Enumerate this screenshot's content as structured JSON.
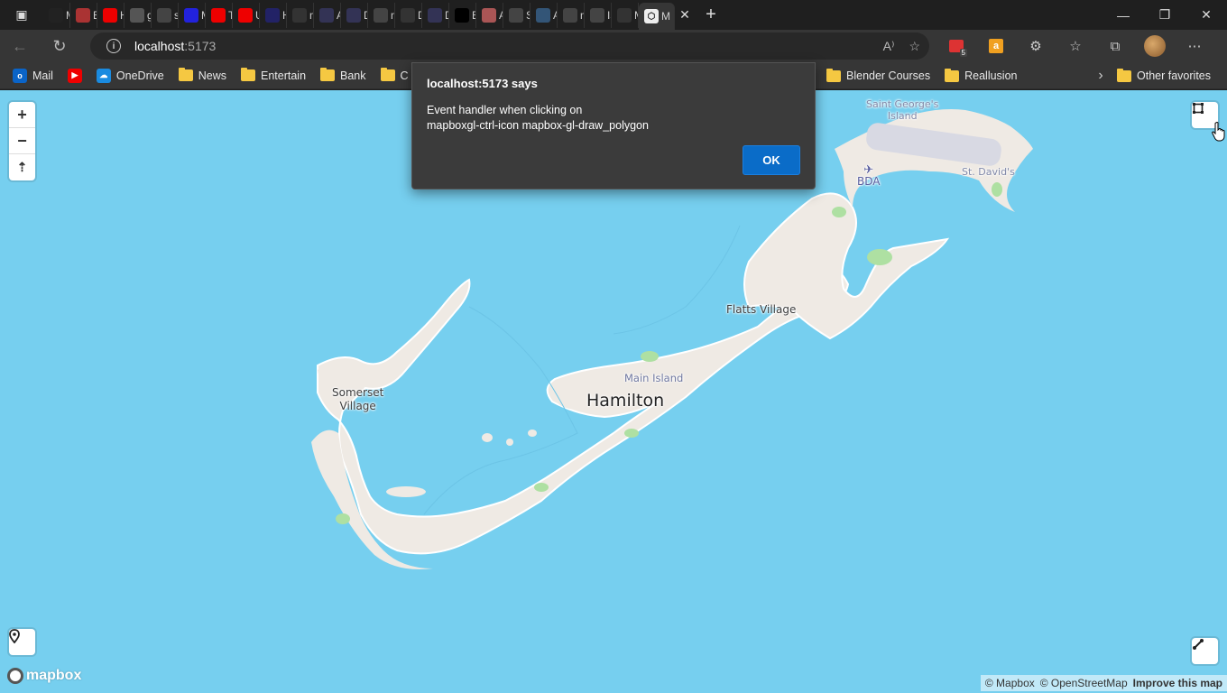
{
  "browser": {
    "tabs": [
      {
        "title": "M",
        "icon": "y-icon",
        "color": "#222"
      },
      {
        "title": "B",
        "icon": "t-icon",
        "color": "#a33"
      },
      {
        "title": "H",
        "icon": "youtube-icon",
        "color": "#e00"
      },
      {
        "title": "gi",
        "icon": "google-icon",
        "color": "#555"
      },
      {
        "title": "sc",
        "icon": "github-icon",
        "color": "#444"
      },
      {
        "title": "M",
        "icon": "site-icon",
        "color": "#22d"
      },
      {
        "title": "Tr",
        "icon": "youtube-icon",
        "color": "#e00"
      },
      {
        "title": "U",
        "icon": "youtube-icon",
        "color": "#e00"
      },
      {
        "title": "H",
        "icon": "site-icon",
        "color": "#226"
      },
      {
        "title": "m",
        "icon": "page-icon",
        "color": "#333"
      },
      {
        "title": "A",
        "icon": "copilot-icon",
        "color": "#335"
      },
      {
        "title": "D",
        "icon": "copilot-icon",
        "color": "#335"
      },
      {
        "title": "m",
        "icon": "github-icon",
        "color": "#444"
      },
      {
        "title": "D",
        "icon": "page-icon",
        "color": "#333"
      },
      {
        "title": "D",
        "icon": "copilot-icon",
        "color": "#335"
      },
      {
        "title": "B",
        "icon": "medium-icon",
        "color": "#000"
      },
      {
        "title": "A",
        "icon": "site-icon",
        "color": "#a55"
      },
      {
        "title": "St",
        "icon": "github-icon",
        "color": "#444"
      },
      {
        "title": "A",
        "icon": "site-icon",
        "color": "#357"
      },
      {
        "title": "m",
        "icon": "github-icon",
        "color": "#444"
      },
      {
        "title": "Is",
        "icon": "github-icon",
        "color": "#444"
      },
      {
        "title": "M",
        "icon": "page-icon",
        "color": "#333"
      }
    ],
    "active_tab": {
      "title": "M",
      "icon": "codepen-icon"
    },
    "address": {
      "host": "localhost",
      "port": ":5173"
    },
    "extension_badge": "5",
    "bookmarks": [
      {
        "label": "Mail",
        "icon": "outlook-icon",
        "color": "#0a64c8",
        "glyph": "o"
      },
      {
        "label": "",
        "icon": "youtube-icon",
        "color": "#e00",
        "glyph": "▶"
      },
      {
        "label": "OneDrive",
        "icon": "onedrive-icon",
        "color": "#1a8be0",
        "glyph": "☁"
      },
      {
        "label": "News",
        "icon": "folder-icon"
      },
      {
        "label": "Entertain",
        "icon": "folder-icon"
      },
      {
        "label": "Bank",
        "icon": "folder-icon"
      },
      {
        "label": "C",
        "icon": "folder-icon"
      }
    ],
    "bookmarks_right": [
      {
        "label": "Blender Courses",
        "icon": "folder-icon"
      },
      {
        "label": "Reallusion",
        "icon": "folder-icon"
      }
    ],
    "other_favorites": "Other favorites"
  },
  "map": {
    "labels": {
      "st_georges": "Saint George's\nIsland",
      "bda": "BDA",
      "st_davids": "St. David's",
      "flatts": "Flatts Village",
      "main_island": "Main Island",
      "hamilton": "Hamilton",
      "somerset": "Somerset\nVillage"
    },
    "controls": {
      "zoom_in": "+",
      "zoom_out": "−",
      "compass": "⇡"
    },
    "logo": "mapbox",
    "attribution": {
      "mapbox": "© Mapbox",
      "osm": "© OpenStreetMap",
      "improve": "Improve this map"
    }
  },
  "dialog": {
    "title": "localhost:5173 says",
    "message_line1": "Event handler when clicking on",
    "message_line2": "mapboxgl-ctrl-icon mapbox-gl-draw_polygon",
    "ok_label": "OK"
  }
}
